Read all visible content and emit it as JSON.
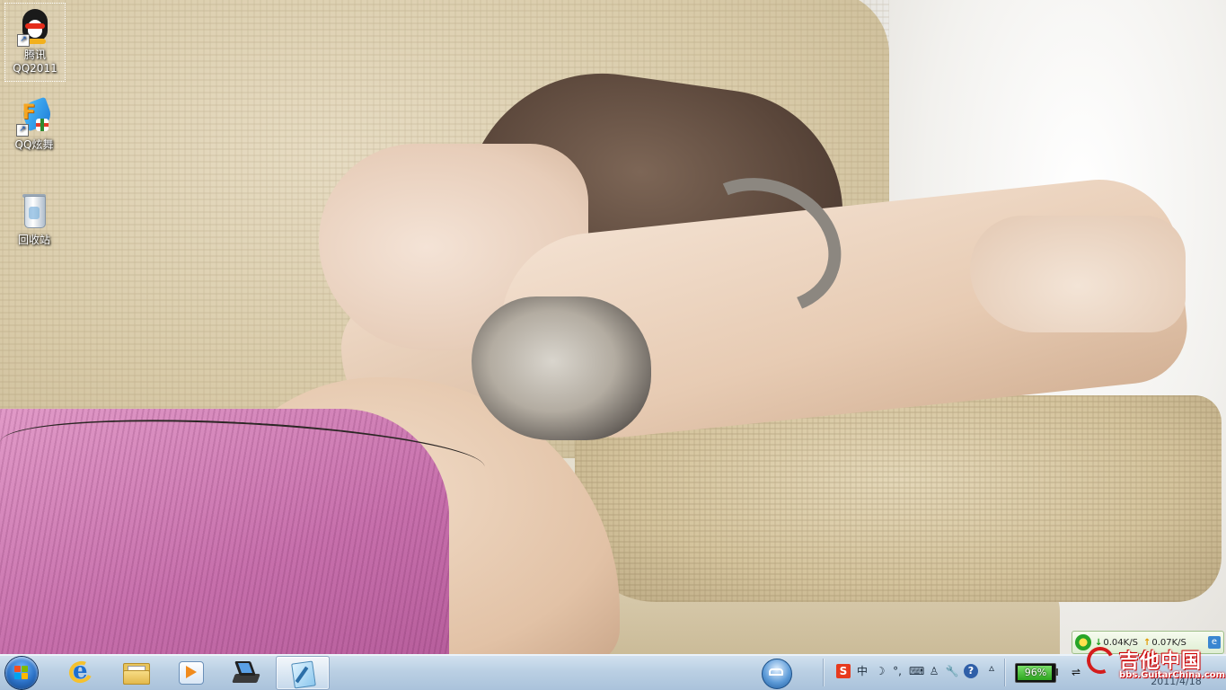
{
  "desktop": {
    "icons": [
      {
        "label_line1": "腾讯",
        "label_line2": "QQ2011",
        "icon": "qq-penguin-icon",
        "selected": true
      },
      {
        "label_line1": "QQ炫舞",
        "icon": "qq-dance-icon"
      },
      {
        "label_line1": "回收站",
        "icon": "recycle-bin-icon"
      }
    ]
  },
  "netmon": {
    "down_arrow": "↓",
    "down_speed": "0.04K/S",
    "up_arrow": "↑",
    "up_speed": "0.07K/S"
  },
  "taskbar": {
    "pinned": [
      {
        "name": "internet-explorer",
        "icon": "internet-explorer-icon"
      },
      {
        "name": "windows-explorer",
        "icon": "folder-icon"
      },
      {
        "name": "media-player",
        "icon": "media-player-icon"
      },
      {
        "name": "webcam",
        "icon": "webcam-icon"
      },
      {
        "name": "notepad",
        "icon": "notepad-icon",
        "active": true
      }
    ],
    "tray": {
      "ime_s": "S",
      "ime_zh": "中",
      "moon": "☽",
      "punct": "°,",
      "keyboard": "⌨",
      "user": "♙",
      "tools": "🔧",
      "help": "?",
      "expand": "▵"
    },
    "battery": {
      "percent_label": "96%",
      "percent": 96,
      "plug": "⇌"
    },
    "clock": {
      "date": "2011/4/18"
    }
  },
  "watermark": {
    "brand": "吉他中国",
    "url": "bbs.GuitarChina.com"
  },
  "colors": {
    "taskbar_top": "#d2e2f0",
    "taskbar_bottom": "#a8c1db",
    "battery_green": "#2da51f",
    "watermark_red": "#d41c1c"
  }
}
